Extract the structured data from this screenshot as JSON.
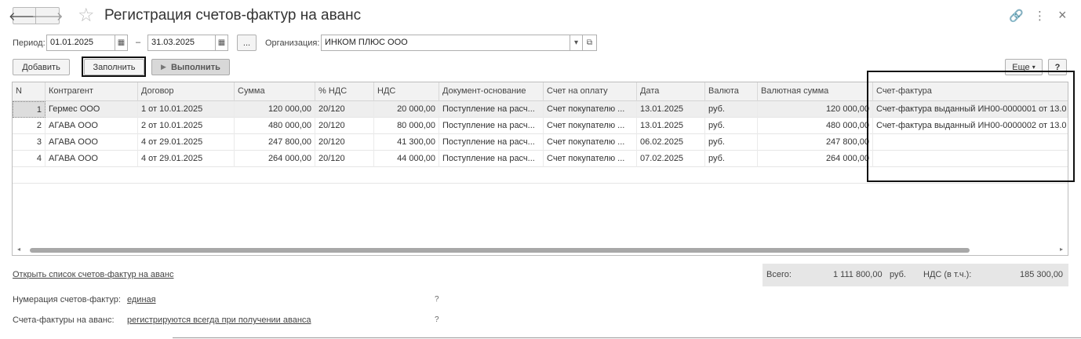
{
  "window": {
    "title": "Регистрация счетов-фактур на аванс",
    "back_glyph": "🡐",
    "forward_glyph": "🡒",
    "star_glyph": "☆",
    "link_glyph": "🔗",
    "more_glyph": "⋮",
    "close_glyph": "×"
  },
  "filters": {
    "period_label": "Период:",
    "period_from": "01.01.2025",
    "period_dash": "–",
    "period_to": "31.03.2025",
    "period_choose": "...",
    "org_label": "Организация:",
    "org_value": "ИНКОМ ПЛЮС ООО",
    "calendar_glyph": "▦",
    "dropdown_glyph": "▾",
    "open_glyph": "⧉"
  },
  "toolbar": {
    "add": "Добавить",
    "fill": "Заполнить",
    "run": "Выполнить",
    "run_glyph": "▶",
    "more": "Еще",
    "more_glyph": "▾",
    "help": "?"
  },
  "table": {
    "columns": [
      "N",
      "Контрагент",
      "Договор",
      "Сумма",
      "% НДС",
      "НДС",
      "Документ-основание",
      "Счет на оплату",
      "Дата",
      "Валюта",
      "Валютная сумма",
      "Счет-фактура"
    ],
    "rows": [
      [
        "1",
        "Гермес ООО",
        "1 от 10.01.2025",
        "120 000,00",
        "20/120",
        "20 000,00",
        "Поступление на расч...",
        "Счет покупателю ...",
        "13.01.2025",
        "руб.",
        "120 000,00",
        "Счет-фактура выданный ИН00-0000001 от 13.0"
      ],
      [
        "2",
        "АГАВА  ООО",
        "2 от 10.01.2025",
        "480 000,00",
        "20/120",
        "80 000,00",
        "Поступление на расч...",
        "Счет покупателю ...",
        "13.01.2025",
        "руб.",
        "480 000,00",
        "Счет-фактура выданный ИН00-0000002 от 13.0"
      ],
      [
        "3",
        "АГАВА  ООО",
        "4 от 29.01.2025",
        "247 800,00",
        "20/120",
        "41 300,00",
        "Поступление на расч...",
        "Счет покупателю ...",
        "06.02.2025",
        "руб.",
        "247 800,00",
        ""
      ],
      [
        "4",
        "АГАВА  ООО",
        "4 от 29.01.2025",
        "264 000,00",
        "20/120",
        "44 000,00",
        "Поступление на расч...",
        "Счет покупателю ...",
        "07.02.2025",
        "руб.",
        "264 000,00",
        ""
      ]
    ],
    "scroll_left": "◂",
    "scroll_right": "▸"
  },
  "footer": {
    "open_list_link": "Открыть список счетов-фактур на аванс",
    "total_label": "Всего:",
    "total_value": "1 111 800,00",
    "total_currency": "руб.",
    "vat_label": "НДС (в т.ч.):",
    "vat_value": "185 300,00",
    "numbering_label": "Нумерация счетов-фактур:",
    "numbering_value": "единая",
    "advance_label": "Счета-фактуры на аванс:",
    "advance_value": "регистрируются всегда при получении аванса",
    "help_mark": "?"
  }
}
